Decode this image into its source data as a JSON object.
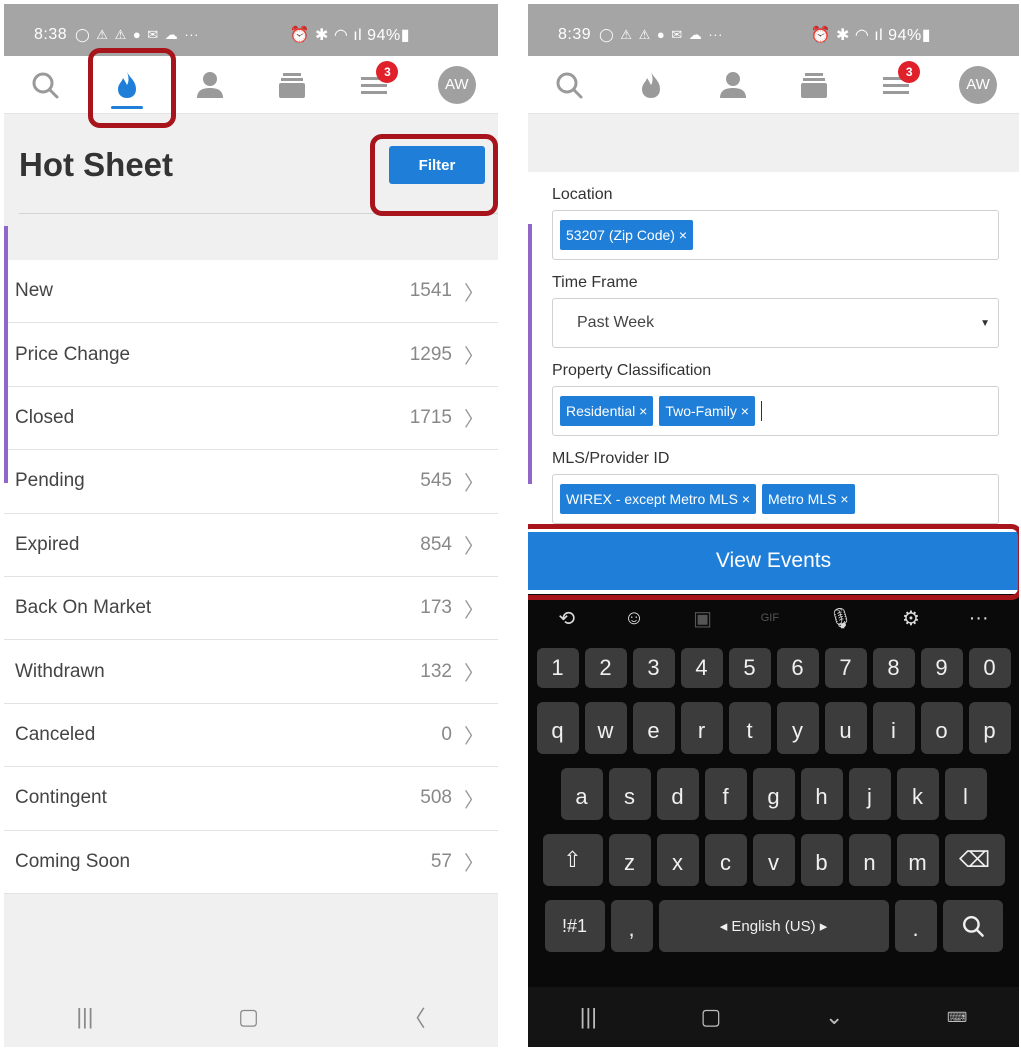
{
  "left": {
    "status": {
      "time": "8:38",
      "icons": "◯ ⚠ ⚠ ● ✉ ☁ ···",
      "right": "⏰ ✱ ◠ ıl 94%▮"
    },
    "nav": {
      "avatar": "AW",
      "badge": "3"
    },
    "title": "Hot Sheet",
    "filter_label": "Filter",
    "rows": [
      {
        "label": "New",
        "count": "1541"
      },
      {
        "label": "Price Change",
        "count": "1295"
      },
      {
        "label": "Closed",
        "count": "1715"
      },
      {
        "label": "Pending",
        "count": "545"
      },
      {
        "label": "Expired",
        "count": "854"
      },
      {
        "label": "Back On Market",
        "count": "173"
      },
      {
        "label": "Withdrawn",
        "count": "132"
      },
      {
        "label": "Canceled",
        "count": "0"
      },
      {
        "label": "Contingent",
        "count": "508"
      },
      {
        "label": "Coming Soon",
        "count": "57"
      }
    ]
  },
  "right": {
    "status": {
      "time": "8:39",
      "icons": "◯ ⚠ ⚠ ● ✉ ☁ ···",
      "right": "⏰ ✱ ◠ ıl 94%▮"
    },
    "nav": {
      "avatar": "AW",
      "badge": "3"
    },
    "location_label": "Location",
    "location_tag": "53207 (Zip Code) ×",
    "timeframe_label": "Time Frame",
    "timeframe_value": "Past Week",
    "classification_label": "Property Classification",
    "class_tags": [
      "Residential ×",
      "Two-Family ×"
    ],
    "mls_label": "MLS/Provider ID",
    "mls_tags": [
      "WIREX - except Metro MLS ×",
      "Metro MLS ×"
    ],
    "view_events": "View Events",
    "keyboard": {
      "numbers": [
        "1",
        "2",
        "3",
        "4",
        "5",
        "6",
        "7",
        "8",
        "9",
        "0"
      ],
      "row1": [
        "q",
        "w",
        "e",
        "r",
        "t",
        "y",
        "u",
        "i",
        "o",
        "p"
      ],
      "row2": [
        "a",
        "s",
        "d",
        "f",
        "g",
        "h",
        "j",
        "k",
        "l"
      ],
      "row3": [
        "z",
        "x",
        "c",
        "v",
        "b",
        "n",
        "m"
      ],
      "symbols": "!#1",
      "comma": ",",
      "space": "◂ English (US) ▸",
      "period": "."
    }
  },
  "colors": {
    "accent": "#1f7fd8",
    "highlight": "#a8141c",
    "badge": "#e0212b",
    "side_bar": "#9066c8"
  },
  "icons": [
    "search-icon",
    "flame-icon",
    "person-icon",
    "stack-icon",
    "menu-icon",
    "home-icon",
    "back-icon"
  ]
}
